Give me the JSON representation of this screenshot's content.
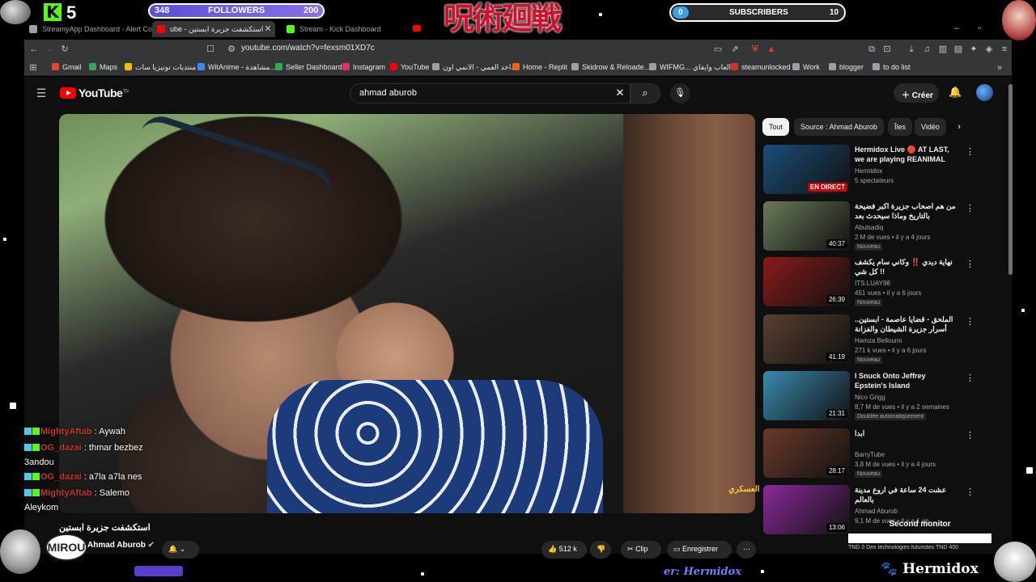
{
  "overlay": {
    "kick_icon": "K",
    "kick_count": "5",
    "followers": {
      "current": "348",
      "label": "FOLLOWERS",
      "goal": "200"
    },
    "jjk_logo": "呪術廻戦",
    "subscribers": {
      "current": "0",
      "label": "SUBSCRIBERS",
      "goal": "10"
    }
  },
  "browser": {
    "tabs": [
      {
        "label": "StreamyApp Dashboard - Alert Confi",
        "icon_color": "#9aa0a6"
      },
      {
        "label": "ube - استكشفت جزيرة ابستين",
        "icon_color": "#ff0000",
        "active": true
      },
      {
        "label": "Stream - Kick Dashboard",
        "icon_color": "#53fc18"
      }
    ],
    "url": "youtube.com/watch?v=fexsm01XD7c",
    "bookmarks": [
      {
        "label": "Gmail",
        "color": "#ea4335"
      },
      {
        "label": "Maps",
        "color": "#34a853"
      },
      {
        "label": "منتديات تونيزيا سات",
        "color": "#fbbc05"
      },
      {
        "label": "WitAnime - مشاهدة...",
        "color": "#4285f4"
      },
      {
        "label": "Seller Dashboard",
        "color": "#34a853"
      },
      {
        "label": "Instagram",
        "color": "#e1306c"
      },
      {
        "label": "YouTube",
        "color": "#ff0000"
      },
      {
        "label": "اخد العمي - الانمي اون...",
        "color": "#9aa0a6"
      },
      {
        "label": "Home - Replit",
        "color": "#f26207"
      },
      {
        "label": "Skidrow & Reloade...",
        "color": "#9aa0a6"
      },
      {
        "label": "WIFMG... العاب وايفاي",
        "color": "#9aa0a6"
      },
      {
        "label": "steamunlocked",
        "color": "#d93025"
      },
      {
        "label": "Work",
        "color": "#9aa0a6"
      },
      {
        "label": "blogger",
        "color": "#9aa0a6"
      },
      {
        "label": "to do list",
        "color": "#9aa0a6"
      }
    ]
  },
  "youtube": {
    "logo_text": "YouTube",
    "logo_sup": "TN",
    "search_value": "ahmad aburob",
    "create_label": "Créer",
    "video": {
      "watermark": "العسكري",
      "title": "استكشفت جزيرة ابستين",
      "channel": "Ahmad Aburob",
      "likes": "512 k",
      "clip_label": "Clip",
      "save_label": "Enregistrer"
    },
    "chips": [
      "Tout",
      "Source : Ahmad Aburob",
      "Îles",
      "Vidéo"
    ],
    "recommendations": [
      {
        "title": "Hermidox Live 🔴 AT LAST, we are playing REANIMAL 🔥",
        "channel": "Hermidox",
        "meta": "5 spectateurs",
        "badge": "",
        "overlay": "EN DIRECT",
        "live": true,
        "thumb": "#1b4d7a"
      },
      {
        "title": "من هم اصحاب جزيرة اكبر فضيحة بالتاريخ وماذا سيحدث بعد التسريبات",
        "channel": "Abulsadiq",
        "meta": "2 M de vues • il y a 4 jours",
        "badge": "Nouveau",
        "overlay": "40:37",
        "live": false,
        "thumb": "#6a7a5a"
      },
      {
        "title": "نهاية ديدي ‼️ وكاني سام يكشف كل شي !!",
        "channel": "ITS.LUAY98",
        "meta": "451 vues • il y a 6 jours",
        "badge": "Nouveau",
        "overlay": "26:39",
        "live": false,
        "thumb": "#8a1a1a"
      },
      {
        "title": "الملحق - قضايا عاصمة - ابستين.. أسرار جزيرة الشيطان والفزانة 24 !!",
        "channel": "Hamza Belloumi",
        "meta": "271 k vues • il y a 6 jours",
        "badge": "Nouveau",
        "overlay": "41:19",
        "live": false,
        "thumb": "#5a4030"
      },
      {
        "title": "I Snuck Onto Jeffrey Epstein's Island",
        "channel": "Nico Grigg",
        "meta": "8,7 M de vues • il y a 2 semaines",
        "badge": "Doublée automatiquement",
        "overlay": "21:31",
        "live": false,
        "thumb": "#3a8ab0"
      },
      {
        "title": "ابدا",
        "channel": "BarryTube",
        "meta": "3,8 M de vues • il y a 4 jours",
        "badge": "Nouveau",
        "overlay": "28:17",
        "live": false,
        "thumb": "#6a3a2a"
      },
      {
        "title": "عشت 24 ساعة في اروع مدينة بالعالم",
        "channel": "Ahmad Aburob",
        "meta": "9,1 M de vues • il y a 1 an",
        "badge": "",
        "overlay": "13:06",
        "live": false,
        "thumb": "#8a2a9a"
      }
    ]
  },
  "chat": [
    {
      "user": "MightyAftab",
      "color": "#c0392b",
      "msg": ": Aywah",
      "cont": ""
    },
    {
      "user": "OG_dazai",
      "color": "#c0392b",
      "msg": ": thmar bezbez",
      "cont": "3andou"
    },
    {
      "user": "OG_dazai",
      "color": "#c0392b",
      "msg": ": a7la a7la nes",
      "cont": ""
    },
    {
      "user": "MightyAftab",
      "color": "#c0392b",
      "msg": ": Salemo",
      "cont": "Aleykom"
    }
  ],
  "bottom": {
    "mirou": "MIROU",
    "second_monitor": "Second monitor",
    "ticker": "TND 0   Des technologies futuristes   TND 400",
    "hermidox": "🐾 Hermidox",
    "hermidox_small": "er: Hermidox"
  }
}
